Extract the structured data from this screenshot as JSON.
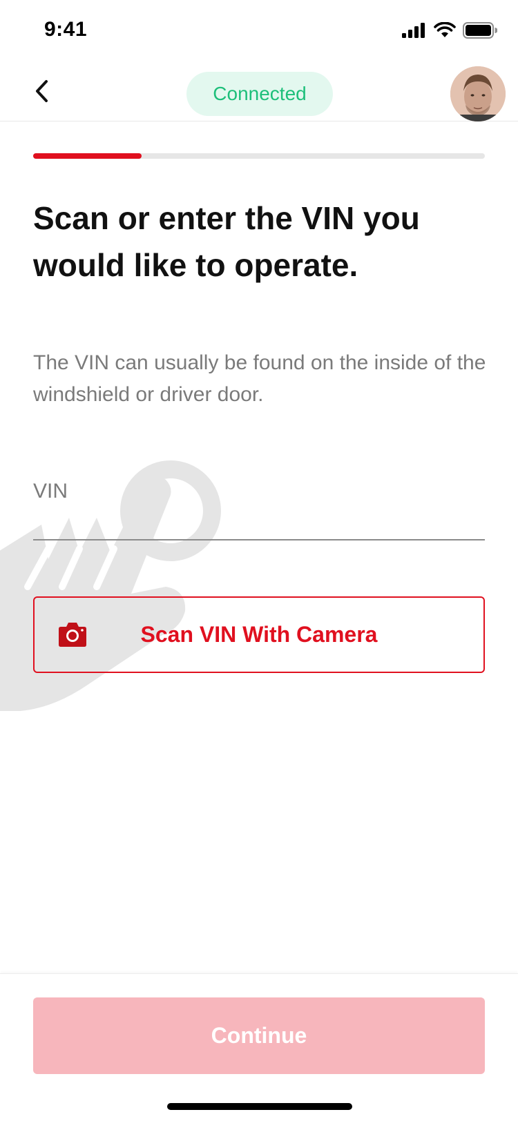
{
  "status_bar": {
    "time": "9:41",
    "icons": [
      "signal-icon",
      "wifi-icon",
      "battery-icon"
    ]
  },
  "nav": {
    "back_icon": "chevron-left-icon",
    "status_badge": "Connected",
    "avatar_alt": "user-avatar"
  },
  "progress": {
    "fraction": 0.24,
    "fill_color": "#e0101f",
    "track_color": "#e6e6e6"
  },
  "content": {
    "headline": "Scan or enter the VIN you would like to operate.",
    "hint": "The VIN can usually be found on the inside of the windshield or driver door."
  },
  "vin_field": {
    "label": "VIN",
    "value": ""
  },
  "scan_button": {
    "icon": "camera-icon",
    "label": "Scan VIN With Camera"
  },
  "footer": {
    "continue_label": "Continue"
  },
  "colors": {
    "accent": "#e0101f",
    "success": "#1dbf7a",
    "success_bg": "#e3f8ef",
    "disabled_button": "#f7b6bc"
  }
}
